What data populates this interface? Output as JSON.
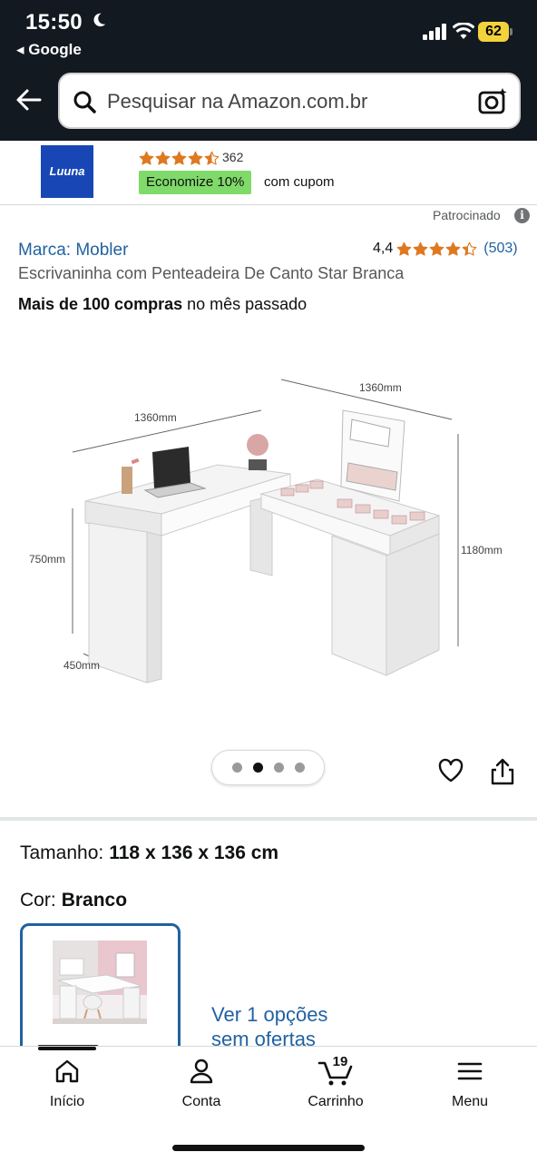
{
  "status_bar": {
    "time": "15:50",
    "back_app": "◂ Google",
    "battery": "62"
  },
  "search": {
    "placeholder": "Pesquisar na Amazon.com.br"
  },
  "sponsor_banner": {
    "logo_text": "Luuna",
    "rating_count": "362",
    "rating_value": 4.5,
    "coupon_badge": "Economize 10%",
    "coupon_text": "com cupom"
  },
  "product": {
    "sponsored_label": "Patrocinado",
    "brand": "Marca: Mobler",
    "rating": "4,4",
    "rating_stars": 4.4,
    "review_count": "(503)",
    "title": "Escrivaninha com Penteadeira De Canto Star Branca",
    "bought_bold": "Mais de 100 compras",
    "bought_rest": " no mês passado",
    "image_labels": {
      "width_left": "1360mm",
      "width_right": "1360mm",
      "height_left": "750mm",
      "height_right": "1180mm",
      "depth": "450mm"
    },
    "image_count": 4,
    "image_current": 2
  },
  "variations": {
    "size_label": "Tamanho:",
    "size_value": "118 x 136 x 136 cm",
    "color_label": "Cor:",
    "color_value": "Branco",
    "see_options_line1": "Ver 1 opções",
    "see_options_line2": "sem ofertas"
  },
  "bottom_nav": {
    "items": [
      {
        "label": "Início",
        "icon": "home-icon",
        "active": true
      },
      {
        "label": "Conta",
        "icon": "account-icon"
      },
      {
        "label": "Carrinho",
        "icon": "cart-icon"
      },
      {
        "label": "Menu",
        "icon": "menu-icon"
      }
    ],
    "cart_count": "19"
  },
  "colors": {
    "header_bg": "#131921",
    "link_blue": "#2162a1",
    "star_orange": "#de7921",
    "coupon_green": "#7fda69",
    "battery_yellow": "#f3d33b"
  }
}
